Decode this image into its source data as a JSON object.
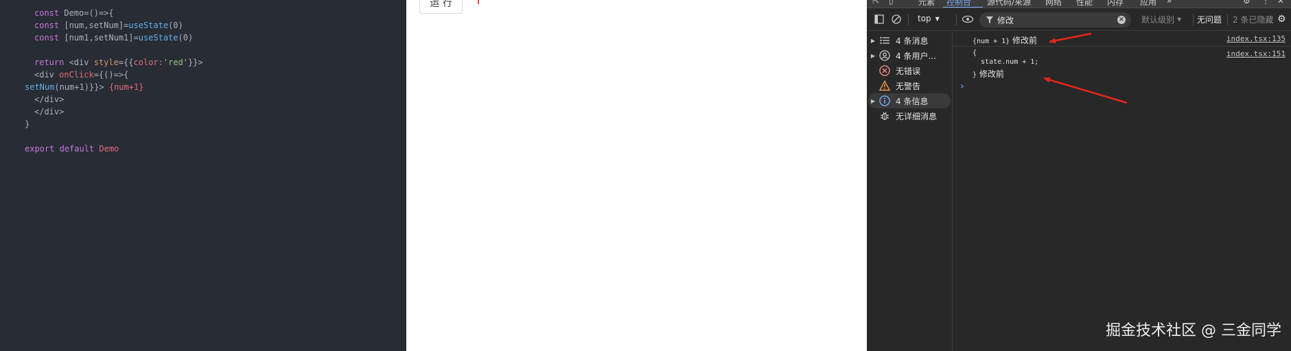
{
  "editor": {
    "lines": [
      [
        {
          "t": "const ",
          "c": "kw"
        },
        {
          "t": "Demo",
          "c": "pl"
        },
        {
          "t": "=()=>{",
          "c": "pl"
        }
      ],
      [
        {
          "t": "const ",
          "c": "kw"
        },
        {
          "t": "[num,setNum]=",
          "c": "pl"
        },
        {
          "t": "useState",
          "c": "fn"
        },
        {
          "t": "(0)",
          "c": "pl"
        }
      ],
      [
        {
          "t": "const ",
          "c": "kw"
        },
        {
          "t": "[num1,setNum1]=",
          "c": "pl"
        },
        {
          "t": "useState",
          "c": "fn"
        },
        {
          "t": "(0)",
          "c": "pl"
        }
      ],
      [],
      [
        {
          "t": "return ",
          "c": "kw"
        },
        {
          "t": "<div ",
          "c": "pl"
        },
        {
          "t": "style",
          "c": "attr"
        },
        {
          "t": "={{",
          "c": "pl"
        },
        {
          "t": "color:",
          "c": "tag"
        },
        {
          "t": "'red'",
          "c": "str"
        },
        {
          "t": "}}>",
          "c": "pl"
        }
      ],
      [
        {
          "t": "<div ",
          "c": "pl"
        },
        {
          "t": "onClick",
          "c": "tag"
        },
        {
          "t": "={()=>{",
          "c": "pl"
        }
      ],
      [
        {
          "t": "setNum",
          "c": "fn"
        },
        {
          "t": "(num+1)}}> ",
          "c": "pl"
        },
        {
          "t": "{num+1}",
          "c": "tag"
        }
      ],
      [
        {
          "t": "</div>",
          "c": "pl"
        }
      ],
      [
        {
          "t": "</div>",
          "c": "pl"
        }
      ],
      [
        {
          "t": "}",
          "c": "pl"
        }
      ],
      [],
      [
        {
          "t": "export default ",
          "c": "kw"
        },
        {
          "t": "Demo",
          "c": "tag"
        }
      ]
    ]
  },
  "preview": {
    "run_label": "运 行"
  },
  "devtools": {
    "tabs": [
      "元素",
      "控制台",
      "源代码/来源",
      "网络",
      "性能",
      "内存",
      "应用"
    ],
    "toolbar": {
      "context": "top",
      "filter_value": "修改",
      "levels": "默认级别",
      "issues": "无问题",
      "hidden": "2 条已隐藏"
    },
    "sidebar": [
      {
        "label": "4 条消息",
        "icon": "list-icon",
        "arrow": true,
        "selected": false
      },
      {
        "label": "4 条用户...",
        "icon": "user-icon",
        "arrow": true,
        "selected": false
      },
      {
        "label": "无错误",
        "icon": "error-icon",
        "arrow": false,
        "selected": false
      },
      {
        "label": "无警告",
        "icon": "warning-icon",
        "arrow": false,
        "selected": false
      },
      {
        "label": "4 条信息",
        "icon": "info-icon",
        "arrow": true,
        "selected": true
      },
      {
        "label": "无详细消息",
        "icon": "bug-icon",
        "arrow": false,
        "selected": false
      }
    ],
    "console": {
      "log1": {
        "code": "{num + 1}",
        "text": " 修改前",
        "source": "index.tsx:135"
      },
      "log2": {
        "open": "{",
        "body": "  state.num + 1;",
        "close": "}",
        "text": " 修改前",
        "source": "index.tsx:151"
      }
    }
  },
  "watermark": "掘金技术社区 @ 三金同学",
  "colors": {
    "editor_bg": "#282c34",
    "devtools_bg": "#282828",
    "accent": "#7cacf8",
    "arrow": "#e8261e"
  }
}
